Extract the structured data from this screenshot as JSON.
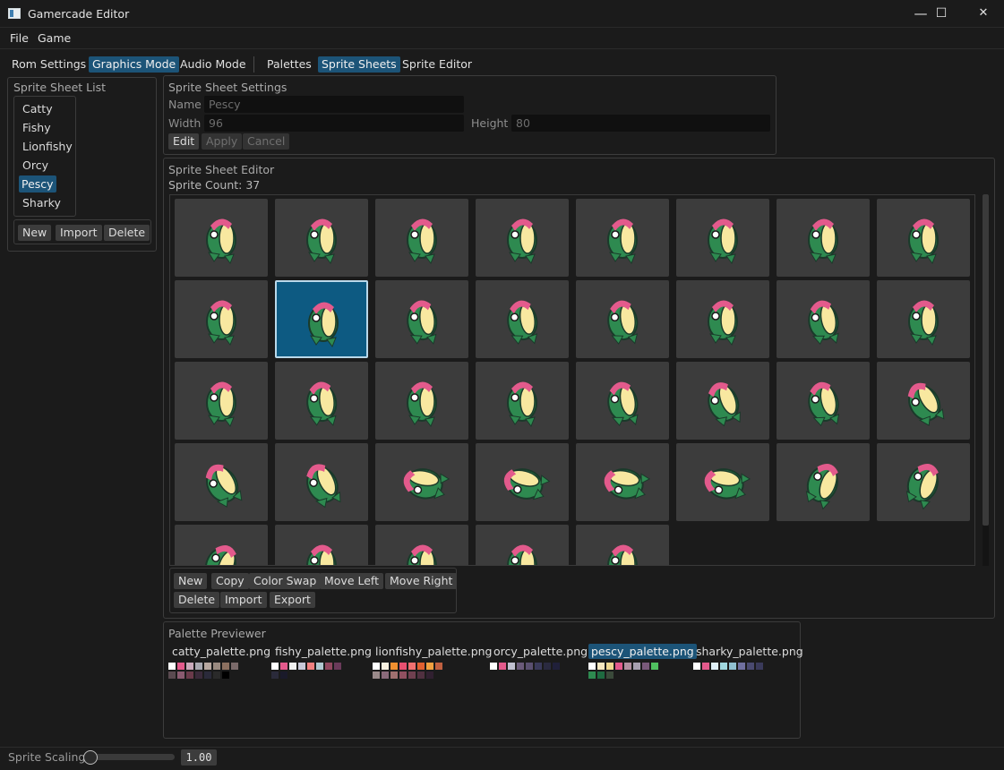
{
  "window": {
    "title": "Gamercade Editor",
    "minimize": "—",
    "maximize": "☐",
    "close": "✕"
  },
  "menu": [
    "File",
    "Game"
  ],
  "tabs": [
    "Rom Settings",
    "Graphics Mode",
    "Audio Mode",
    "Palettes",
    "Sprite Sheets",
    "Sprite Editor"
  ],
  "sprite_sheet_list": {
    "title": "Sprite Sheet List",
    "items": [
      "Catty",
      "Fishy",
      "Lionfishy",
      "Orcy",
      "Pescy",
      "Sharky"
    ],
    "selected": "Pescy",
    "buttons": {
      "new": "New",
      "import": "Import",
      "delete": "Delete"
    }
  },
  "settings": {
    "title": "Sprite Sheet Settings",
    "name_label": "Name",
    "name_value": "Pescy",
    "width_label": "Width",
    "width_value": "96",
    "height_label": "Height",
    "height_value": "80",
    "buttons": {
      "edit": "Edit",
      "apply": "Apply",
      "cancel": "Cancel"
    }
  },
  "editor": {
    "title": "Sprite Sheet Editor",
    "count_text": "Sprite Count: 37",
    "selected_index": 9,
    "buttons": {
      "new": "New",
      "copy": "Copy",
      "color_swap": "Color Swap",
      "move_left": "Move Left",
      "move_right": "Move Right",
      "delete": "Delete",
      "import": "Import",
      "export": "Export"
    }
  },
  "palette_previewer": {
    "title": "Palette Previewer",
    "palettes": [
      {
        "name": "catty_palette.png",
        "colors": [
          "#ffffff",
          "#e35a8c",
          "#c9aabb",
          "#a8a8b0",
          "#b8a8a0",
          "#9a8a80",
          "#8c7060",
          "#7a6a6a",
          "#5a4a50",
          "#8a5a70",
          "#6a3a4a",
          "#3a2a3a",
          "#2a2a3a",
          "#2a2a2a",
          "#000000"
        ]
      },
      {
        "name": "fishy_palette.png",
        "colors": [
          "#ffffff",
          "#e35a8c",
          "#f0f0f0",
          "#c8c8d8",
          "#f08080",
          "#b0c8d0",
          "#904860",
          "#6a3a5a",
          "#2a2a3a",
          "#1a1a2a"
        ]
      },
      {
        "name": "lionfishy_palette.png",
        "colors": [
          "#ffffff",
          "#f8f0e0",
          "#f09030",
          "#e85070",
          "#f07070",
          "#e06030",
          "#f0a040",
          "#c06040",
          "#9a8a8a",
          "#8a6a7a",
          "#a07070",
          "#905060",
          "#704050",
          "#503040",
          "#302030"
        ]
      },
      {
        "name": "orcy_palette.png",
        "colors": [
          "#ffffff",
          "#e35a8c",
          "#c0c0d0",
          "#6a5a7a",
          "#5a5070",
          "#3a3a5a",
          "#2a2a40",
          "#20203a"
        ]
      },
      {
        "name": "pescy_palette.png",
        "colors": [
          "#ffffff",
          "#f8e8c0",
          "#f0d890",
          "#e35a8c",
          "#b090a0",
          "#a8a0b0",
          "#7a5a7a",
          "#50c060",
          "#2e8a50",
          "#1e6a40",
          "#3a4a3a"
        ]
      },
      {
        "name": "sharky_palette.png",
        "colors": [
          "#ffffff",
          "#e35a8c",
          "#e0f0f8",
          "#a0d8e0",
          "#90c0d0",
          "#7070a0",
          "#4a4a70",
          "#3a3a5a"
        ]
      }
    ],
    "selected": "pescy_palette.png"
  },
  "status": {
    "scaling_label": "Sprite Scaling:",
    "scaling_value": "1.00",
    "scaling_fraction": 0.0
  },
  "colors": {
    "accent": "#1c5478",
    "selected_cell": "#0d5a82"
  }
}
